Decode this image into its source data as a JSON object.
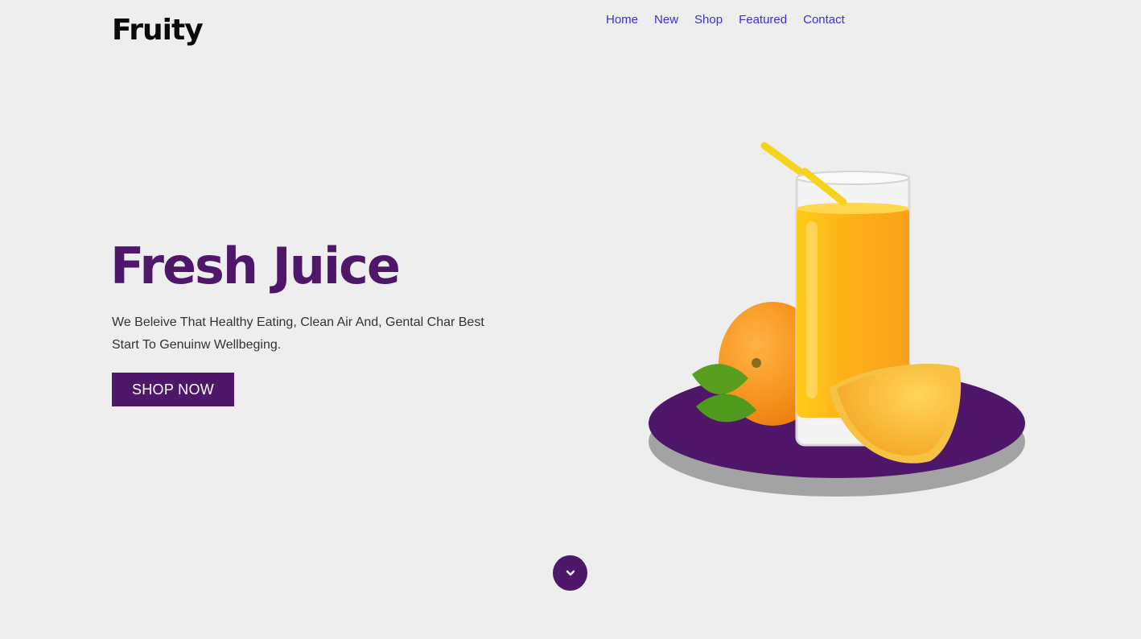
{
  "brand": {
    "logo_text": "Fruity"
  },
  "nav": {
    "items": [
      {
        "label": "Home"
      },
      {
        "label": "New"
      },
      {
        "label": "Shop"
      },
      {
        "label": "Featured"
      },
      {
        "label": "Contact"
      }
    ]
  },
  "hero": {
    "title": "Fresh Juice",
    "description": "We Beleive That Healthy Eating, Clean Air And, Gental Char Best Start To Genuinw Wellbeging.",
    "cta_label": "SHOP NOW",
    "image_icon": "juice-glass-with-oranges-illustration"
  },
  "scroll": {
    "icon": "chevron-down-icon"
  },
  "colors": {
    "background": "#eeeeee",
    "accent": "#4e176a",
    "nav_link": "#3b2fd6"
  }
}
